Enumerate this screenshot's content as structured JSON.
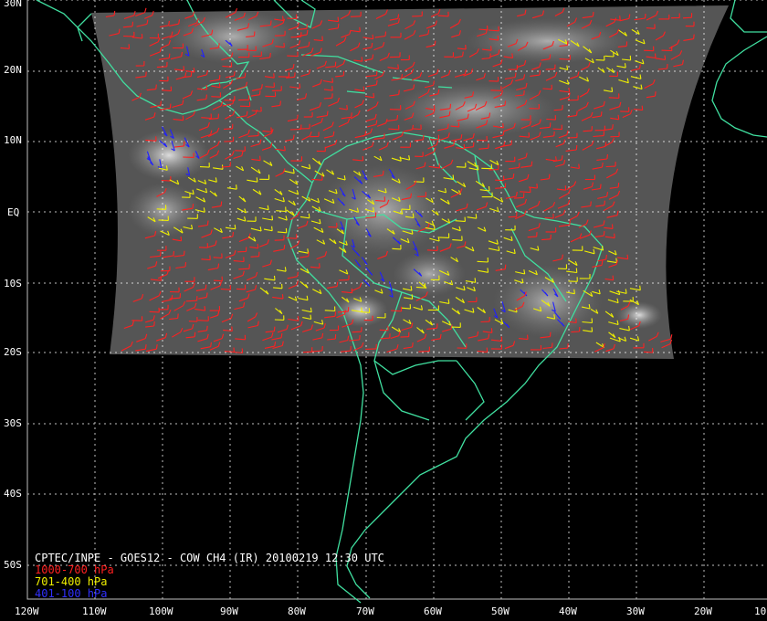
{
  "map": {
    "title": "CPTEC/INPE - GOES12 - COW CH4 (IR) 20100219 12:30 UTC",
    "legend": [
      {
        "label": "1000-700 hPa",
        "color": "#ff2020"
      },
      {
        "label": "701-400 hPa",
        "color": "#f0f000"
      },
      {
        "label": "401-100 hPa",
        "color": "#2020ff"
      }
    ],
    "lat_labels": [
      "30N",
      "20N",
      "10N",
      "EQ",
      "10S",
      "20S",
      "30S",
      "40S",
      "50S"
    ],
    "lon_labels": [
      "120W",
      "110W",
      "100W",
      "90W",
      "80W",
      "70W",
      "60W",
      "50W",
      "40W",
      "30W",
      "20W",
      "10"
    ],
    "colors": {
      "background": "#000000",
      "coastline": "#40e0a0",
      "grid": "#ffffff",
      "satellite_gray": "#5a5a5a"
    }
  }
}
